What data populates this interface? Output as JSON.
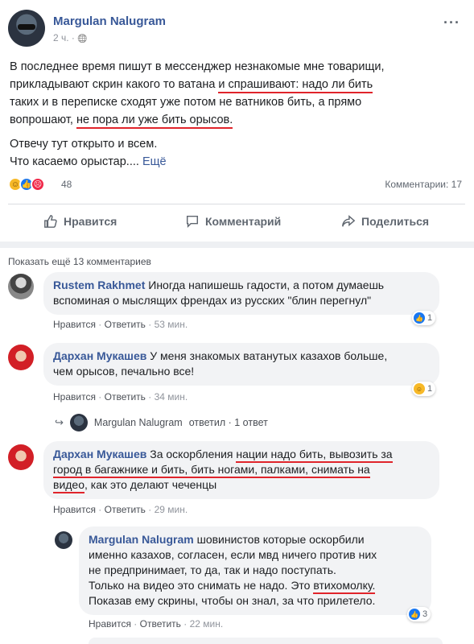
{
  "post": {
    "author": "Margulan Nalugram",
    "time": "2 ч. ·",
    "globe": "🌐",
    "more": "···",
    "text_l1_a": "В последнее время пишут в мессенджер незнакомые мне товарищи,",
    "text_l2_a": "прикладывают скрин какого то ватана ",
    "text_l2_b": "и спрашивают: надо ли бить",
    "text_l3_a": "таких и в переписке сходят уже потом не ватников бить, а прямо",
    "text_l4_a": "вопрошают, ",
    "text_l4_b": "не пора ли уже бить орысов.",
    "text_l5": "Отвечу тут открыто и всем.",
    "text_l6_a": "Что касаемо орыстар.... ",
    "see_more": "Ещё",
    "reactions_count": "48",
    "comments_count": "Комментарии: 17"
  },
  "actions": {
    "like": "Нравится",
    "comment": "Комментарий",
    "share": "Поделиться"
  },
  "show_more": "Показать ещё 13 комментариев",
  "comments": [
    {
      "name": "Rustem Rakhmet",
      "text_a": " Иногда напишешь гадости, а потом думаешь",
      "text_b": "вспоминая о мыслящих френдах из русских \"блин перегнул\"",
      "like": "Нравится",
      "reply": "Ответить",
      "time": "53 мин.",
      "badge": "1"
    },
    {
      "name": "Дархан Мукашев",
      "text_a": " У меня знакомых ватанутых казахов больше,",
      "text_b": "чем орысов, печально все!",
      "like": "Нравится",
      "reply": "Ответить",
      "time": "34 мин.",
      "badge": "1"
    },
    {
      "name": "Дархан Мукашев",
      "text_a1": " За оскорбления ",
      "text_a2": "нации надо бить, вывозить за",
      "text_b1": "город в багажнике и бить, бить ногами, палками, снимать на",
      "text_c1": "видео",
      "text_c2": ", как это делают чеченцы",
      "like": "Нравится",
      "reply": "Ответить",
      "time": "29 мин."
    },
    {
      "name": "Margulan Nalugram",
      "text_a": " шовинистов которые оскорбили",
      "text_b": "именно казахов, согласен, если мвд ничего против них",
      "text_c": "не предпринимает, то да, так и надо поступать.",
      "text_d1": "Только на видео это снимать не надо. Это ",
      "text_d2": "втихомолку.",
      "text_e": "Показав ему скрины, чтобы он знал, за что прилетело.",
      "like": "Нравится",
      "reply": "Ответить",
      "time": "22 мин.",
      "badge": "3"
    }
  ],
  "reply_summary": {
    "name": "Margulan Nalugram",
    "text": "ответил · 1 ответ"
  },
  "sep": "·",
  "colors": {
    "link": "#385898",
    "underline": "#e0242b",
    "like_blue": "#1877f2"
  }
}
